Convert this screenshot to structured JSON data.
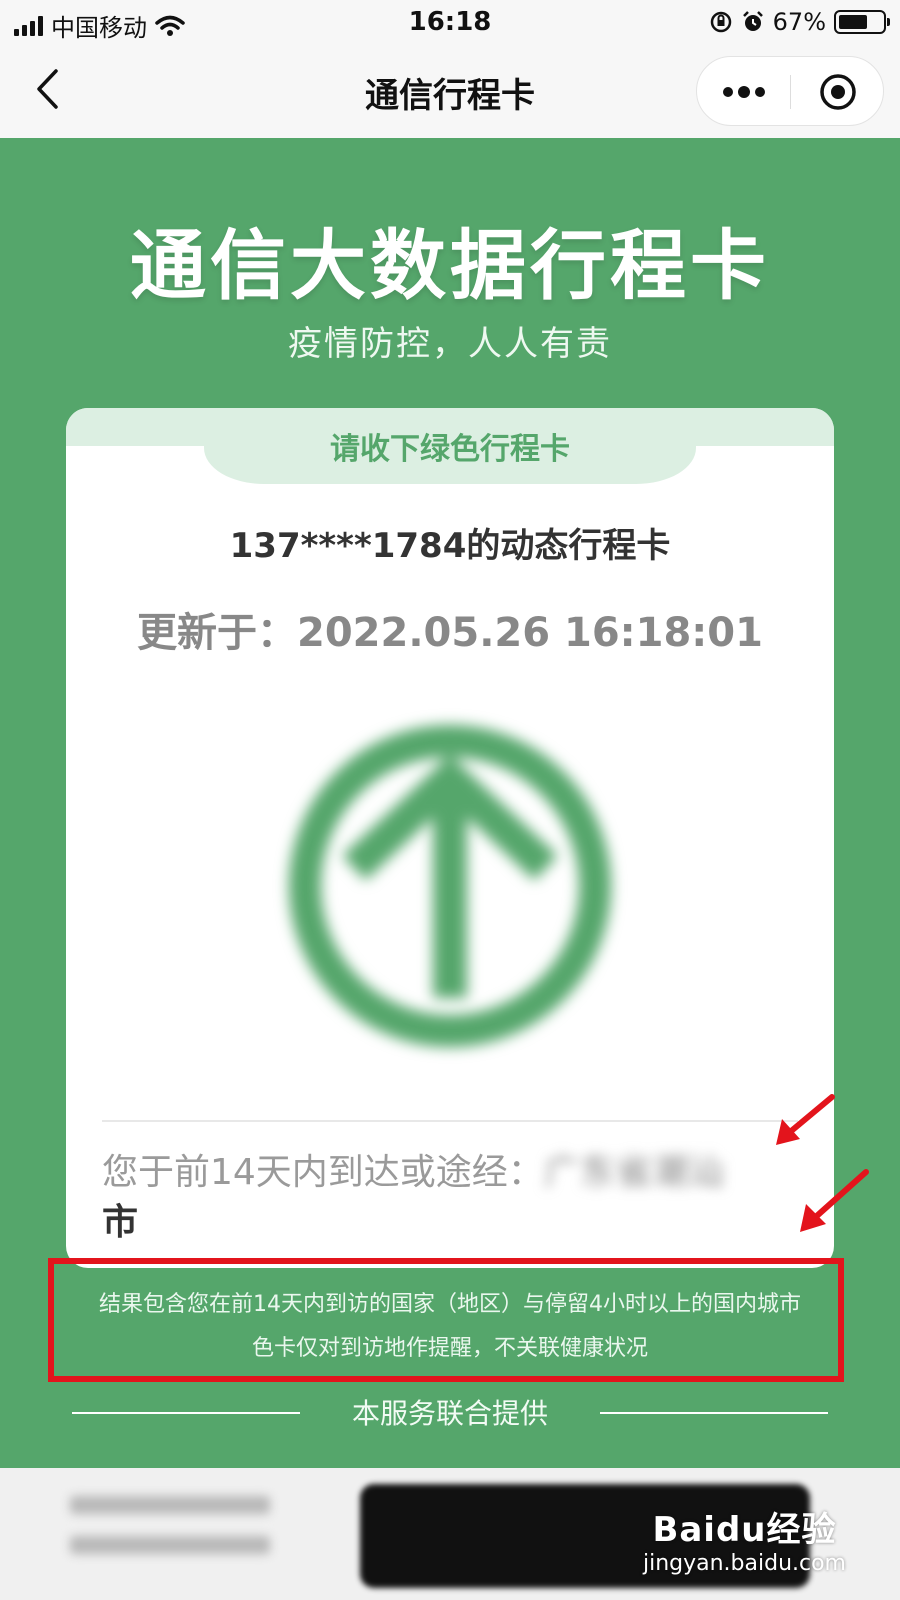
{
  "status_bar": {
    "carrier": "中国移动",
    "time": "16:18",
    "battery": "67%",
    "battery_level": 0.67
  },
  "nav": {
    "title": "通信行程卡"
  },
  "hero": {
    "title": "通信大数据行程卡",
    "subtitle": "疫情防控，人人有责"
  },
  "card": {
    "tab_label": "请收下绿色行程卡",
    "phone_title": "137****1784的动态行程卡",
    "updated": "更新于：2022.05.26 16:18:01",
    "status_color": "#55a66b",
    "visited_prefix": "您于前14天内到达或途经：",
    "visited_blurred": "广东省潮汕",
    "visited_tail": "市"
  },
  "notes": {
    "line1": "结果包含您在前14天内到访的国家（地区）与停留4小时以上的国内城市",
    "line2": "色卡仅对到访地作提醒，不关联健康状况"
  },
  "footer": {
    "provided_by": "本服务联合提供"
  },
  "watermark": {
    "brand": "Baidu经验",
    "url": "jingyan.baidu.com"
  },
  "colors": {
    "primary_green": "#55a66b",
    "light_green": "#dcefe2",
    "highlight_red": "#e3141c"
  }
}
